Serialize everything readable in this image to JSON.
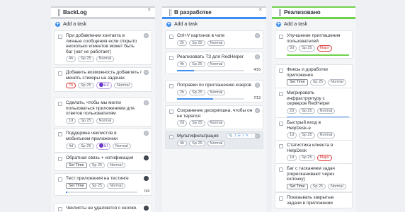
{
  "columns": [
    {
      "title": "BackLog",
      "add_task": "Add a task",
      "close_glyph": "×",
      "header_color": "#cfd3d9",
      "cards": [
        {
          "title": "При добавлении контакта в личные сообщения если открыто несколько клиентов может быть баг (нат не работает)",
          "tags": [
            "4h",
            "Sp 25",
            "Normal"
          ]
        },
        {
          "title": "Добавить возможность добавлять / менять стикеры на задачах",
          "tags": [
            "7h",
            "Sp 25",
            "UX",
            "Normal"
          ]
        },
        {
          "title": "Сделать, чтобы мы могли пользоваться приложением для ответов пользователям",
          "tags": [
            "1d",
            "Sp 25",
            "Normal"
          ]
        },
        {
          "title": "Поддержка чеклистов в мобильном приложении",
          "tags": [
            "4d",
            "Sp 25",
            "UI",
            "Normal"
          ]
        },
        {
          "title": "Обратная связь + нотификация",
          "tags": [
            "Set Time",
            "Sp 25",
            "Normal"
          ]
        },
        {
          "title": "Тест приложения на тестинге",
          "tags": [
            "Set Time",
            "Sp 25",
            "Normal"
          ],
          "progress_label": "0/4"
        },
        {
          "title": "Чеклисты не удаляются с кнопки.",
          "tags": []
        }
      ]
    },
    {
      "title": "В разработке",
      "add_task": "Add a task",
      "close_glyph": "×",
      "header_color": "#3d8ef2",
      "cards": [
        {
          "title": "Ctrl+V картинок в чате",
          "tags": [
            "2h",
            "Sp 25",
            "Normal"
          ]
        },
        {
          "title": "Реализовать ТЗ для RedHelper",
          "tags": [
            "4h",
            "Sp 25",
            "Normal"
          ],
          "progress_label": "4/16",
          "progress": 0.25
        },
        {
          "title": "Поправки по приглашению юзеров",
          "tags": [
            "2h",
            "Sp 25",
            "Normal"
          ],
          "progress_label": "7/13",
          "progress": 0.54
        },
        {
          "title": "Сохранение дескрипшна, чтобы он не терялся",
          "tags": [
            "2d",
            "Sp 25",
            "Normal"
          ]
        },
        {
          "title": "Мультифильтрация",
          "tags": [
            "4h",
            "Sp 25",
            "Normal"
          ],
          "toolbar": [
            "1",
            "1"
          ]
        }
      ]
    },
    {
      "title": "Реализовано",
      "add_task": "Add a task",
      "close_glyph": "×",
      "header_color": "#6fd24a",
      "cards": [
        {
          "title": "Улучшение приглашения пользователей",
          "tags": [
            "3d",
            "Sp 25",
            "Major"
          ],
          "bottom_bar": "#6fd24a"
        },
        {
          "title": "Фиксы и доработки приложения",
          "tags": [
            "Set Time",
            "Sp 25",
            "Normal"
          ],
          "bottom_bar": "#3d8ef2"
        },
        {
          "title": "Мигрировать инфраструктуру с серверов RedHelper",
          "tags": [
            "2d",
            "Sp 25",
            "Normal"
          ],
          "bottom_bar": "#3d8ef2"
        },
        {
          "title": "Быстрый вход в HelpDesk-е",
          "tags": [
            "1d",
            "Sp 25",
            "Normal"
          ],
          "bottom_bar": "#3d8ef2"
        },
        {
          "title": "Статистика клиента в HelpDesk",
          "tags": [
            "1d",
            "Sp 25",
            "Major"
          ],
          "bottom_bar": "#6fd24a"
        },
        {
          "title": "Баг с тасканием задач (пересканивают через колонку)",
          "tags": [
            "Set Time",
            "Sp 25",
            "Normal"
          ]
        },
        {
          "title": "Показывать закрытые задачи в приложении",
          "tags": []
        }
      ]
    }
  ]
}
